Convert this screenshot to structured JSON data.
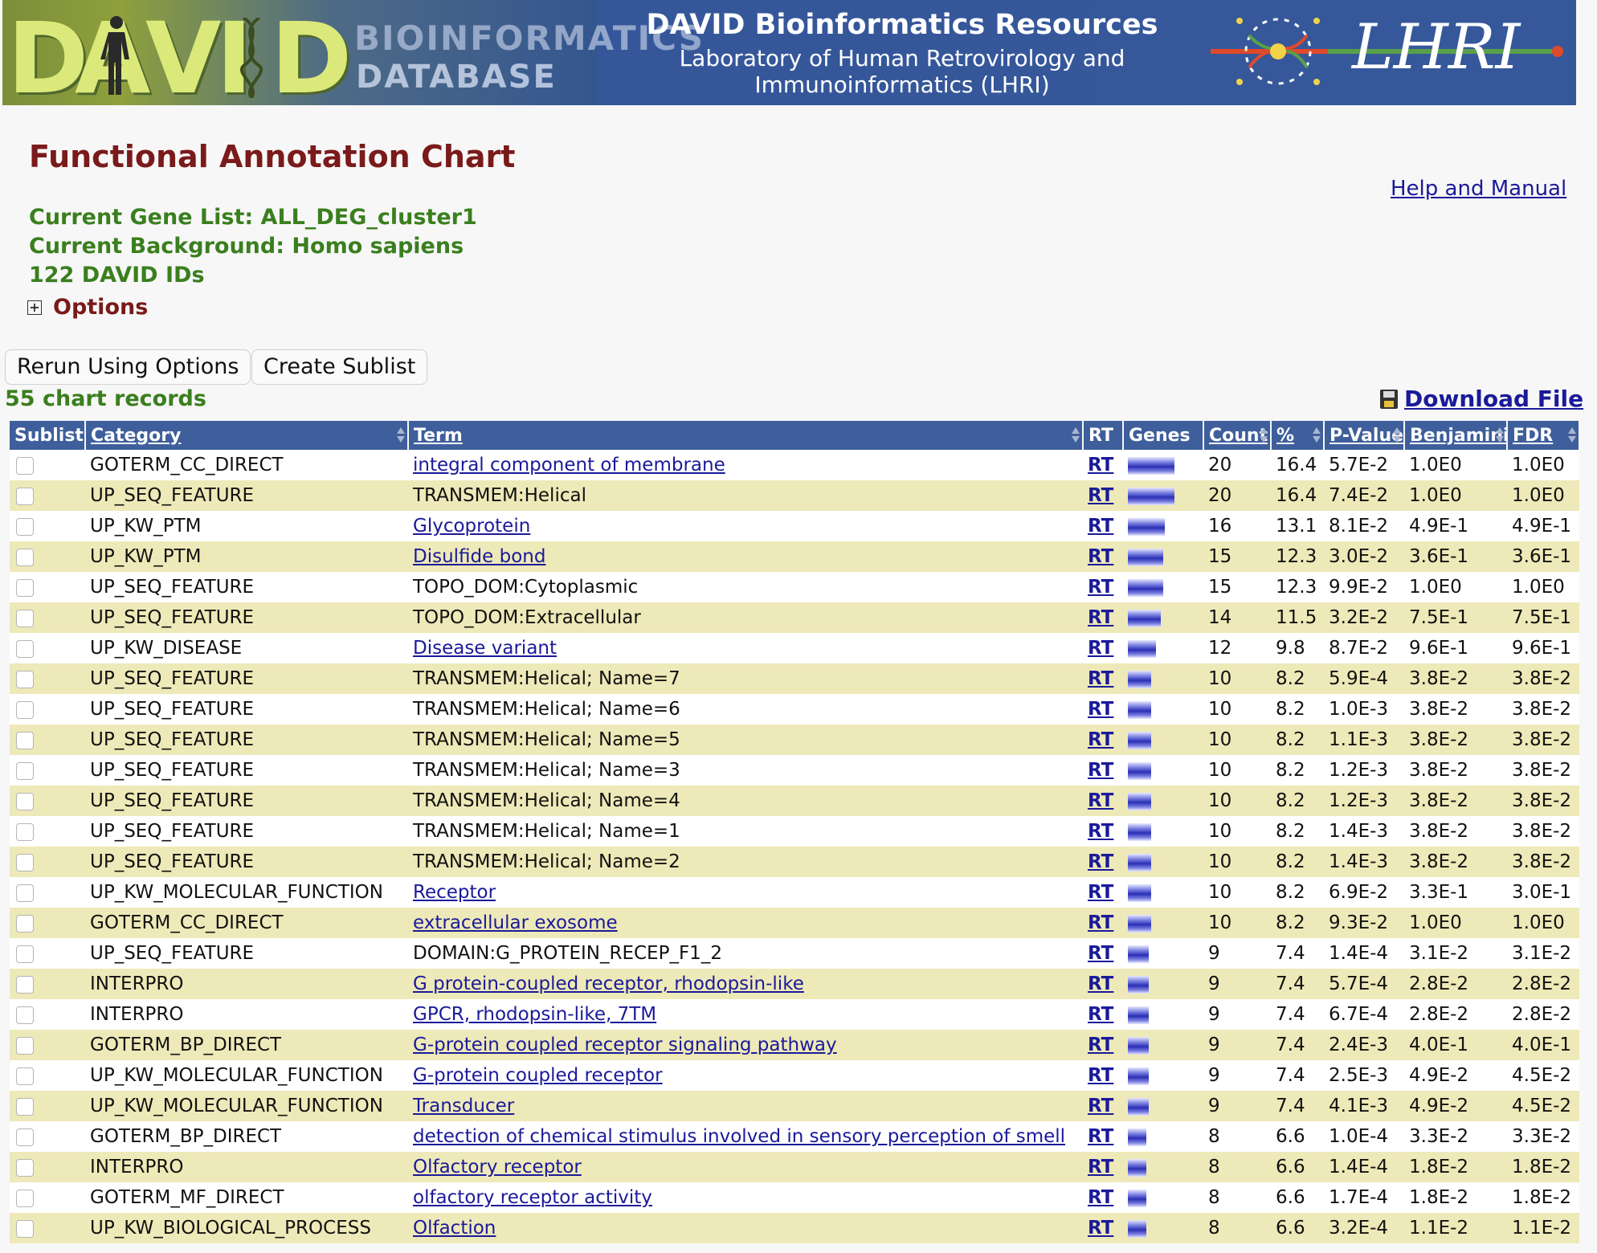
{
  "banner": {
    "title": "DAVID Bioinformatics Resources",
    "subtitle_line1": "Laboratory of Human Retrovirology and",
    "subtitle_line2": "Immunoinformatics (LHRI)",
    "logo_letters": [
      "D",
      "A",
      "V",
      "I",
      "D"
    ],
    "logo_text_top": "BIOINFORMATICS",
    "logo_text_bottom": "DATABASE",
    "lhri_text": "LHRI"
  },
  "page_title": "Functional Annotation Chart",
  "help_link": "Help and Manual",
  "gene_list": "Current Gene List: ALL_DEG_cluster1",
  "background": "Current Background: Homo sapiens",
  "ids": "122 DAVID IDs",
  "options_label": "Options",
  "buttons": {
    "rerun": "Rerun Using Options",
    "create_sublist": "Create Sublist"
  },
  "records_count": "55 chart records",
  "download_label": "Download File",
  "columns": [
    "Sublist",
    "Category",
    "Term",
    "RT",
    "Genes",
    "Count",
    "%",
    "P-Value",
    "Benjamini",
    "FDR"
  ],
  "rows": [
    {
      "category": "GOTERM_CC_DIRECT",
      "term": "integral component of membrane",
      "link": true,
      "rt": "RT",
      "count": "20",
      "pct": "16.4",
      "p": "5.7E-2",
      "benjamini": "1.0E0",
      "fdr": "1.0E0"
    },
    {
      "category": "UP_SEQ_FEATURE",
      "term": "TRANSMEM:Helical",
      "link": false,
      "rt": "RT",
      "count": "20",
      "pct": "16.4",
      "p": "7.4E-2",
      "benjamini": "1.0E0",
      "fdr": "1.0E0"
    },
    {
      "category": "UP_KW_PTM",
      "term": "Glycoprotein",
      "link": true,
      "rt": "RT",
      "count": "16",
      "pct": "13.1",
      "p": "8.1E-2",
      "benjamini": "4.9E-1",
      "fdr": "4.9E-1"
    },
    {
      "category": "UP_KW_PTM",
      "term": "Disulfide bond",
      "link": true,
      "rt": "RT",
      "count": "15",
      "pct": "12.3",
      "p": "3.0E-2",
      "benjamini": "3.6E-1",
      "fdr": "3.6E-1"
    },
    {
      "category": "UP_SEQ_FEATURE",
      "term": "TOPO_DOM:Cytoplasmic",
      "link": false,
      "rt": "RT",
      "count": "15",
      "pct": "12.3",
      "p": "9.9E-2",
      "benjamini": "1.0E0",
      "fdr": "1.0E0"
    },
    {
      "category": "UP_SEQ_FEATURE",
      "term": "TOPO_DOM:Extracellular",
      "link": false,
      "rt": "RT",
      "count": "14",
      "pct": "11.5",
      "p": "3.2E-2",
      "benjamini": "7.5E-1",
      "fdr": "7.5E-1"
    },
    {
      "category": "UP_KW_DISEASE",
      "term": "Disease variant",
      "link": true,
      "rt": "RT",
      "count": "12",
      "pct": "9.8",
      "p": "8.7E-2",
      "benjamini": "9.6E-1",
      "fdr": "9.6E-1"
    },
    {
      "category": "UP_SEQ_FEATURE",
      "term": "TRANSMEM:Helical; Name=7",
      "link": false,
      "rt": "RT",
      "count": "10",
      "pct": "8.2",
      "p": "5.9E-4",
      "benjamini": "3.8E-2",
      "fdr": "3.8E-2"
    },
    {
      "category": "UP_SEQ_FEATURE",
      "term": "TRANSMEM:Helical; Name=6",
      "link": false,
      "rt": "RT",
      "count": "10",
      "pct": "8.2",
      "p": "1.0E-3",
      "benjamini": "3.8E-2",
      "fdr": "3.8E-2"
    },
    {
      "category": "UP_SEQ_FEATURE",
      "term": "TRANSMEM:Helical; Name=5",
      "link": false,
      "rt": "RT",
      "count": "10",
      "pct": "8.2",
      "p": "1.1E-3",
      "benjamini": "3.8E-2",
      "fdr": "3.8E-2"
    },
    {
      "category": "UP_SEQ_FEATURE",
      "term": "TRANSMEM:Helical; Name=3",
      "link": false,
      "rt": "RT",
      "count": "10",
      "pct": "8.2",
      "p": "1.2E-3",
      "benjamini": "3.8E-2",
      "fdr": "3.8E-2"
    },
    {
      "category": "UP_SEQ_FEATURE",
      "term": "TRANSMEM:Helical; Name=4",
      "link": false,
      "rt": "RT",
      "count": "10",
      "pct": "8.2",
      "p": "1.2E-3",
      "benjamini": "3.8E-2",
      "fdr": "3.8E-2"
    },
    {
      "category": "UP_SEQ_FEATURE",
      "term": "TRANSMEM:Helical; Name=1",
      "link": false,
      "rt": "RT",
      "count": "10",
      "pct": "8.2",
      "p": "1.4E-3",
      "benjamini": "3.8E-2",
      "fdr": "3.8E-2"
    },
    {
      "category": "UP_SEQ_FEATURE",
      "term": "TRANSMEM:Helical; Name=2",
      "link": false,
      "rt": "RT",
      "count": "10",
      "pct": "8.2",
      "p": "1.4E-3",
      "benjamini": "3.8E-2",
      "fdr": "3.8E-2"
    },
    {
      "category": "UP_KW_MOLECULAR_FUNCTION",
      "term": "Receptor",
      "link": true,
      "rt": "RT",
      "count": "10",
      "pct": "8.2",
      "p": "6.9E-2",
      "benjamini": "3.3E-1",
      "fdr": "3.0E-1"
    },
    {
      "category": "GOTERM_CC_DIRECT",
      "term": "extracellular exosome",
      "link": true,
      "rt": "RT",
      "count": "10",
      "pct": "8.2",
      "p": "9.3E-2",
      "benjamini": "1.0E0",
      "fdr": "1.0E0"
    },
    {
      "category": "UP_SEQ_FEATURE",
      "term": "DOMAIN:G_PROTEIN_RECEP_F1_2",
      "link": false,
      "rt": "RT",
      "count": "9",
      "pct": "7.4",
      "p": "1.4E-4",
      "benjamini": "3.1E-2",
      "fdr": "3.1E-2"
    },
    {
      "category": "INTERPRO",
      "term": "G protein-coupled receptor, rhodopsin-like",
      "link": true,
      "rt": "RT",
      "count": "9",
      "pct": "7.4",
      "p": "5.7E-4",
      "benjamini": "2.8E-2",
      "fdr": "2.8E-2"
    },
    {
      "category": "INTERPRO",
      "term": "GPCR, rhodopsin-like, 7TM",
      "link": true,
      "rt": "RT",
      "count": "9",
      "pct": "7.4",
      "p": "6.7E-4",
      "benjamini": "2.8E-2",
      "fdr": "2.8E-2"
    },
    {
      "category": "GOTERM_BP_DIRECT",
      "term": "G-protein coupled receptor signaling pathway",
      "link": true,
      "rt": "RT",
      "count": "9",
      "pct": "7.4",
      "p": "2.4E-3",
      "benjamini": "4.0E-1",
      "fdr": "4.0E-1"
    },
    {
      "category": "UP_KW_MOLECULAR_FUNCTION",
      "term": "G-protein coupled receptor",
      "link": true,
      "rt": "RT",
      "count": "9",
      "pct": "7.4",
      "p": "2.5E-3",
      "benjamini": "4.9E-2",
      "fdr": "4.5E-2"
    },
    {
      "category": "UP_KW_MOLECULAR_FUNCTION",
      "term": "Transducer",
      "link": true,
      "rt": "RT",
      "count": "9",
      "pct": "7.4",
      "p": "4.1E-3",
      "benjamini": "4.9E-2",
      "fdr": "4.5E-2"
    },
    {
      "category": "GOTERM_BP_DIRECT",
      "term": "detection of chemical stimulus involved in sensory perception of smell",
      "link": true,
      "rt": "RT",
      "count": "8",
      "pct": "6.6",
      "p": "1.0E-4",
      "benjamini": "3.3E-2",
      "fdr": "3.3E-2"
    },
    {
      "category": "INTERPRO",
      "term": "Olfactory receptor",
      "link": true,
      "rt": "RT",
      "count": "8",
      "pct": "6.6",
      "p": "1.4E-4",
      "benjamini": "1.8E-2",
      "fdr": "1.8E-2"
    },
    {
      "category": "GOTERM_MF_DIRECT",
      "term": "olfactory receptor activity",
      "link": true,
      "rt": "RT",
      "count": "8",
      "pct": "6.6",
      "p": "1.7E-4",
      "benjamini": "1.8E-2",
      "fdr": "1.8E-2"
    },
    {
      "category": "UP_KW_BIOLOGICAL_PROCESS",
      "term": "Olfaction",
      "link": true,
      "rt": "RT",
      "count": "8",
      "pct": "6.6",
      "p": "3.2E-4",
      "benjamini": "1.1E-2",
      "fdr": "1.1E-2"
    }
  ],
  "colors": {
    "banner_bg": "#35579a",
    "header_bg": "#3e5f9b",
    "odd_row": "#eee9b8",
    "title_red": "#7a1a1a",
    "info_green": "#3a7f1e",
    "link_blue": "#1a1a9a"
  }
}
